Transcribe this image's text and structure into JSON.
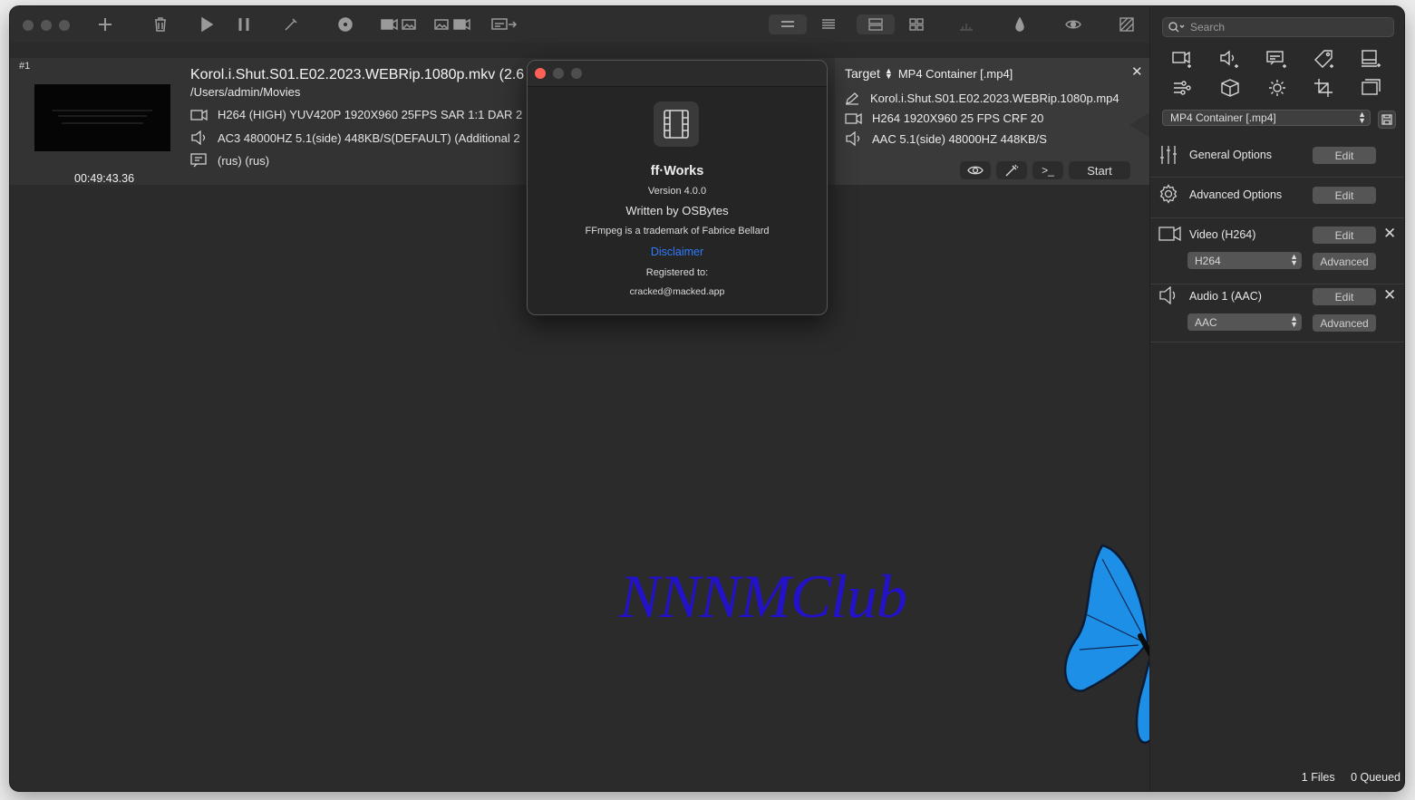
{
  "toolbar": {
    "icons": [
      "add-icon",
      "trash-icon",
      "play-icon",
      "pause-icon",
      "wand-icon",
      "disc-icon",
      "video-to-image-icon",
      "image-to-video-icon",
      "subtitle-export-icon"
    ],
    "views": [
      "list-compact-view-icon",
      "list-detail-view-icon",
      "list-expanded-view-icon",
      "grid-view-icon",
      "chart-icon",
      "drop-icon",
      "eye-icon",
      "crop-hatch-icon"
    ]
  },
  "job": {
    "number": "#1",
    "duration": "00:49:43.36",
    "title": "Korol.i.Shut.S01.E02.2023.WEBRip.1080p.mkv  (2.6",
    "path": "/Users/admin/Movies",
    "video_info": "H264 (HIGH) YUV420P 1920X960  25FPS  SAR 1:1 DAR 2",
    "audio_info": "AC3 48000HZ 5.1(side) 448KB/S(DEFAULT) (Additional 2",
    "subtitle_info": "(rus) (rus)"
  },
  "target": {
    "label": "Target",
    "container": "MP4 Container [.mp4]",
    "filename": "Korol.i.Shut.S01.E02.2023.WEBRip.1080p.mp4",
    "video": "H264 1920X960 25 FPS CRF 20",
    "audio": "AAC 5.1(side) 48000HZ 448KB/S",
    "start_label": "Start",
    "close_glyph": "✕"
  },
  "about": {
    "app_name": "ff·Works",
    "version": "Version 4.0.0",
    "author": "Written by OSBytes",
    "trademark": "FFmpeg is a trademark of Fabrice Bellard",
    "disclaimer": "Disclaimer",
    "registered_label": "Registered to:",
    "registered_to": "cracked@macked.app",
    "link_color": "#2f7bff"
  },
  "watermark": "NNNMClub",
  "sidebar": {
    "search_placeholder": "Search",
    "container_select": "MP4 Container [.mp4]",
    "general_options": "General Options",
    "advanced_options": "Advanced Options",
    "video_stream": "Video (H264)",
    "audio_stream": "Audio 1 (AAC)",
    "edit_label": "Edit",
    "advanced_label": "Advanced",
    "video_codec": "H264",
    "audio_codec": "AAC",
    "remove_glyph": "✕"
  },
  "footer": {
    "files": "1 Files",
    "queued": "0 Queued"
  }
}
